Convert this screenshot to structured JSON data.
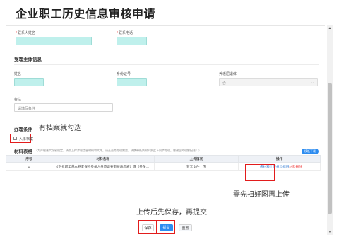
{
  "page": {
    "title": "企业职工历史信息审核申请"
  },
  "applicant": {
    "name_label": "联系人姓名",
    "phone_label": "联系电话"
  },
  "subject": {
    "section_title": "受理主体信息",
    "name_label": "姓名",
    "id_label": "身份证号",
    "insured_type_label": "养老屈退体",
    "insured_type_value": "否",
    "remark_label": "备注",
    "remark_placeholder": "请填写备注"
  },
  "conditions": {
    "section_title": "办理条件",
    "annotation": "有档案就勾选",
    "checkbox_label": "入事档案"
  },
  "materials": {
    "section_title": "材料表格",
    "hint": "（为严格落实保密规定，请勿上传涉密信息材料和文件。请正业务办理需要，请携带纸质材料到此下同步办理。感谢您的理解配合！）",
    "download_label": "模板下载",
    "columns": [
      "序号",
      "材料名称",
      "上传情况",
      "操作"
    ],
    "rows": [
      {
        "index": "1",
        "name": "《企业职工基本养老保险参保人员原退要审核表原表》或《参保…",
        "status": "暂无文件上传",
        "action_upload": "上传材料上传",
        "action_sample": "材料样例",
        "action_delete": "材料删除"
      }
    ],
    "annotation": "需先扫好图再上传"
  },
  "footer": {
    "annotation": "上传后先保存，再提交",
    "save_label": "保存",
    "submit_label": "提交",
    "reset_label": "重置"
  },
  "colors": {
    "accent": "#2d8cf0",
    "highlight_box": "#e21c1c",
    "teal_input": "#bff0ec"
  }
}
